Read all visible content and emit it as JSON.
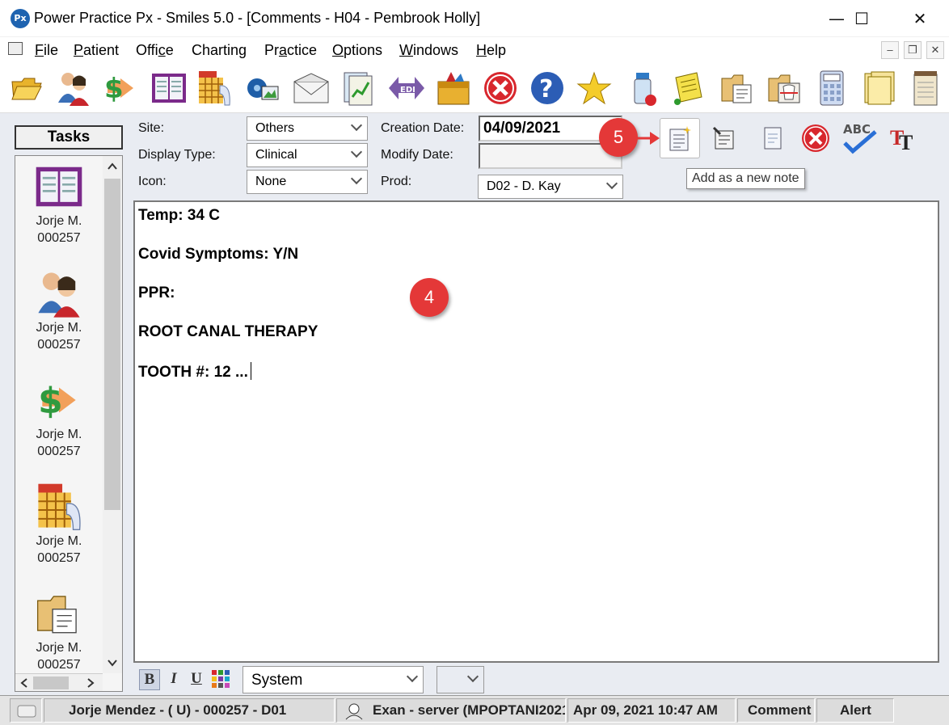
{
  "window": {
    "title": "Power Practice Px - Smiles 5.0 - [Comments - H04 - Pembrook Holly]",
    "logo_text": "Px",
    "minimize": "—",
    "maximize": "☐",
    "close": "✕"
  },
  "menu": {
    "items": [
      {
        "label": "File",
        "underline": "F",
        "rest": "ile"
      },
      {
        "label": "Patient",
        "underline": "P",
        "rest": "atient"
      },
      {
        "label": "Office",
        "pre": "Offi",
        "underline": "c",
        "rest": "e"
      },
      {
        "label": "Charting",
        "underline": "",
        "rest": "Charting"
      },
      {
        "label": "Practice",
        "pre": "Pr",
        "underline": "a",
        "rest": "ctice"
      },
      {
        "label": "Options",
        "underline": "O",
        "rest": "ptions"
      },
      {
        "label": "Windows",
        "underline": "W",
        "rest": "indows"
      },
      {
        "label": "Help",
        "underline": "H",
        "rest": "elp"
      }
    ],
    "mdi_min": "–",
    "mdi_restore": "❐",
    "mdi_close": "✕"
  },
  "toolbar": {
    "icons": [
      "open-folder-icon",
      "patients-icon",
      "billing-icon",
      "book-icon",
      "chart-icon",
      "imaging-icon",
      "mail-icon",
      "report-icon",
      "edi-icon",
      "toolbox-icon",
      "stop-icon",
      "help-icon",
      "favorites-icon",
      "medication-icon",
      "notes-icon",
      "documents-icon",
      "xray-folder-icon",
      "calculator-icon",
      "files-icon",
      "notepad-icon"
    ]
  },
  "tasks": {
    "header": "Tasks",
    "items": [
      {
        "icon": "book-icon",
        "name": "Jorje M.",
        "id": "000257"
      },
      {
        "icon": "patients-icon",
        "name": "Jorje M.",
        "id": "000257"
      },
      {
        "icon": "billing-icon",
        "name": "Jorje M.",
        "id": "000257"
      },
      {
        "icon": "chart-icon",
        "name": "Jorje M.",
        "id": "000257"
      },
      {
        "icon": "document-icon",
        "name": "Jorje M.",
        "id": "000257"
      }
    ]
  },
  "form": {
    "site_label": "Site:",
    "site_value": "Others",
    "display_type_label": "Display Type:",
    "display_type_value": "Clinical",
    "icon_label": "Icon:",
    "icon_value": "None",
    "creation_date_label": "Creation Date:",
    "creation_date_value": "04/09/2021",
    "modify_date_label": "Modify Date:",
    "modify_date_value": "",
    "prod_label": "Prod:",
    "prod_value": "D02 - D. Kay"
  },
  "actions": {
    "tooltip": "Add as a new note",
    "badge_add": "5",
    "badge_editor": "4",
    "spell_label": "ABC",
    "font_label": "TT"
  },
  "editor": {
    "lines": [
      "Temp: 34 C",
      "Covid Symptoms: Y/N",
      "PPR:",
      "ROOT CANAL THERAPY",
      "TOOTH #: 12 ..."
    ]
  },
  "format": {
    "bold": "B",
    "italic": "I",
    "underline": "U",
    "font_value": "System",
    "size_value": ""
  },
  "status": {
    "patient": "Jorje Mendez - ( U) - 000257 - D01",
    "user": "Exan - server (MPOPTANI2021",
    "datetime": "Apr 09, 2021 10:47 AM",
    "mode": "Comment",
    "alert": "Alert"
  },
  "colors": {
    "badge": "#e43838",
    "background": "#e9ecf2",
    "logo": "#1e63b0"
  }
}
